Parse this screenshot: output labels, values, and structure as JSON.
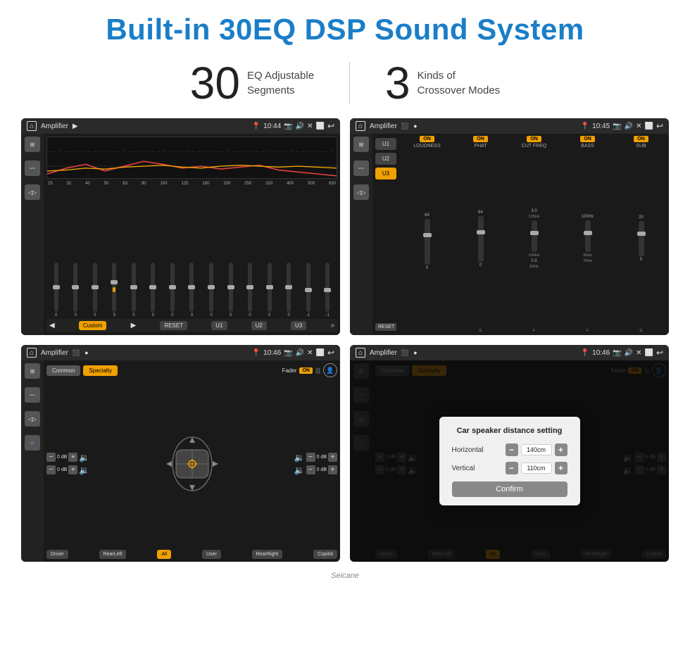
{
  "header": {
    "title": "Built-in 30EQ DSP Sound System"
  },
  "stats": [
    {
      "number": "30",
      "label": "EQ Adjustable\nSegments"
    },
    {
      "number": "3",
      "label": "Kinds of\nCrossover Modes"
    }
  ],
  "screens": {
    "top_left": {
      "title": "Amplifier",
      "time": "10:44",
      "eq_labels": [
        "25",
        "32",
        "40",
        "50",
        "63",
        "80",
        "100",
        "125",
        "160",
        "200",
        "250",
        "320",
        "400",
        "500",
        "630"
      ],
      "eq_values": [
        0,
        0,
        0,
        5,
        0,
        0,
        0,
        0,
        0,
        0,
        0,
        0,
        0,
        -1,
        0,
        -1
      ],
      "bottom_buttons": [
        "Custom",
        "RESET",
        "U1",
        "U2",
        "U3"
      ]
    },
    "top_right": {
      "title": "Amplifier",
      "time": "10:45",
      "presets": [
        "U1",
        "U2",
        "U3"
      ],
      "active_preset": "U3",
      "channels": [
        {
          "label": "LOUDNESS",
          "on": true,
          "value": "ON"
        },
        {
          "label": "PHAT",
          "on": true,
          "value": "ON"
        },
        {
          "label": "CUT FREQ",
          "on": true,
          "value": "ON"
        },
        {
          "label": "BASS",
          "on": true,
          "value": "ON"
        },
        {
          "label": "SUB",
          "on": true,
          "value": "ON"
        }
      ]
    },
    "bottom_left": {
      "title": "Amplifier",
      "time": "10:46",
      "tabs": [
        "Common",
        "Specialty"
      ],
      "active_tab": "Specialty",
      "fader_label": "Fader",
      "fader_on": "ON",
      "channels": [
        {
          "label": "0 dB",
          "side": "left"
        },
        {
          "label": "0 dB",
          "side": "right"
        },
        {
          "label": "0 dB",
          "side": "left2"
        },
        {
          "label": "0 dB",
          "side": "right2"
        }
      ],
      "bottom_buttons": [
        "Driver",
        "RearLeft",
        "All",
        "User",
        "RearRight",
        "Copilot"
      ],
      "active_bottom": "All"
    },
    "bottom_right": {
      "title": "Amplifier",
      "time": "10:46",
      "tabs": [
        "Common",
        "Specialty"
      ],
      "active_tab": "Specialty",
      "dialog": {
        "title": "Car speaker distance setting",
        "horizontal_label": "Horizontal",
        "horizontal_value": "140cm",
        "vertical_label": "Vertical",
        "vertical_value": "110cm",
        "confirm_label": "Confirm"
      },
      "bottom_buttons": [
        "Driver",
        "RearLeft",
        "All",
        "User",
        "RearRight",
        "Copilot"
      ]
    }
  },
  "watermark": "Seicane"
}
